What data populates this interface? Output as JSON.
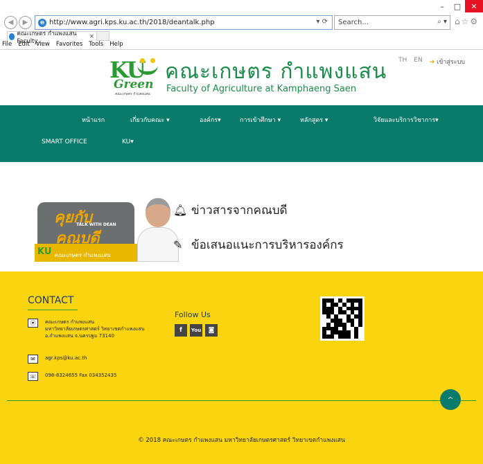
{
  "browser": {
    "url": "http://www.agri.kps.ku.ac.th/2018/deantalk.php",
    "search_placeholder": "Search...",
    "tab_title": "คณะเกษตร กำแพงแสน Faculty...",
    "tab_close": "×",
    "menu": [
      "File",
      "Edit",
      "View",
      "Favorites",
      "Tools",
      "Help"
    ]
  },
  "header": {
    "logo_ku": "KU",
    "logo_green": "Green",
    "logo_sub": "คณะเกษตร กำแพงแสน",
    "title_th": "คณะเกษตร กำแพงแสน",
    "title_en": "Faculty of Agriculture at Kamphaeng Saen",
    "lang_th": "TH",
    "lang_en": "EN",
    "login_arrow": "➔",
    "login": "เข้าสู่ระบบ"
  },
  "nav": {
    "row1": [
      "หน้าแรก",
      "เกี่ยวกับคณะ ▾",
      "องค์กร▾",
      "การเข้าศึกษา ▾",
      "หลักสูตร ▾",
      "วิจัยและบริการวิชาการ▾"
    ],
    "row2": [
      "SMART OFFICE",
      "KU▾"
    ]
  },
  "dean": {
    "banner_line1": "คุยกับ",
    "banner_talk": "TALK WITH DEAN",
    "banner_line2": "คณบดี",
    "banner_ku": "KU",
    "banner_fac": "คณะเกษตร กำแพงแสน",
    "link_news": "ข่าวสารจากคณบดี",
    "link_suggest": "ข้อเสนอแนะการบริหารองค์กร"
  },
  "footer": {
    "contact_title": "CONTACT",
    "address_line1": "คณะเกษตร กำแพงแสน",
    "address_line2": "มหาวิทยาลัยเกษตรศาสตร์ วิทยาเขตกำแพงแสน",
    "address_line3": "อ.กำแพงแสน จ.นครปฐม 73140",
    "email": "agr.kps@ku.ac.th",
    "phone": "098-8324655  Fax 034352435",
    "follow_us": "Follow Us",
    "social": [
      "f",
      "You",
      "◙"
    ],
    "totop": "^",
    "copyright": "© 2018 คณะเกษตร กำแพงแสน มหาวิทยาลัยเกษตรศาสตร์ วิทยาเขตกำแพงแสน"
  },
  "colors": {
    "nav_bg": "#0a7a6a",
    "footer_bg": "#f9d40f",
    "brand_green": "#1a8b4a"
  }
}
